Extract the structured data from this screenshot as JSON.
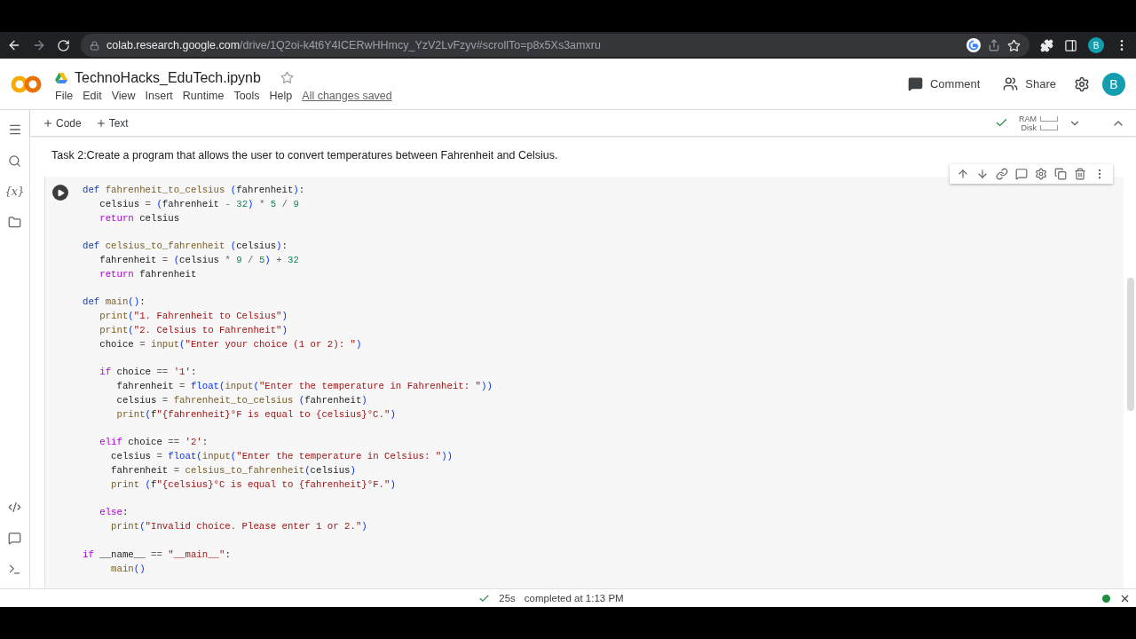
{
  "browser": {
    "url_host": "colab.research.google.com",
    "url_path": "/drive/1Q2oi-k4t6Y4ICERwHHmcy_YzV2LvFzyv#scrollTo=p8x5Xs3amxru",
    "profile": "B"
  },
  "notebook": {
    "title": "TechnoHacks_EduTech.ipynb",
    "menu": [
      "File",
      "Edit",
      "View",
      "Insert",
      "Runtime",
      "Tools",
      "Help"
    ],
    "save_status": "All changes saved",
    "comment": "Comment",
    "share": "Share",
    "avatar": "B"
  },
  "toolbar": {
    "add": [
      "Code",
      "Text"
    ],
    "ram": "RAM",
    "disk": "Disk"
  },
  "sidebar": {
    "variables": "{x}"
  },
  "text_cell": "Task 2:Create a program that allows the user to convert temperatures between Fahrenheit and Celsius.",
  "code_cell": {
    "blocks": [
      [
        "def fahrenheit_to_celsius (fahrenheit):",
        "   celsius = (fahrenheit - 32) * 5 / 9",
        "   return celsius"
      ],
      [
        "def celsius_to_fahrenheit (celsius):",
        "   fahrenheit = (celsius * 9 / 5) + 32",
        "   return fahrenheit"
      ],
      [
        "def main():",
        "   print(\"1. Fahrenheit to Celsius\")",
        "   print(\"2. Celsius to Fahrenheit\")",
        "   choice = input(\"Enter your choice (1 or 2): \")"
      ],
      [
        "   if choice == '1':",
        "      fahrenheit = float(input(\"Enter the temperature in Fahrenheit: \"))",
        "      celsius = fahrenheit_to_celsius (fahrenheit)",
        "      print(f\"{fahrenheit}°F is equal to {celsius}°C.\")"
      ],
      [
        "   elif choice == '2':",
        "     celsius = float(input(\"Enter the temperature in Celsius: \"))",
        "     fahrenheit = celsius_to_fahrenheit(celsius)",
        "     print (f\"{celsius}°C is equal to {fahrenheit}°F.\")"
      ],
      [
        "   else:",
        "     print(\"Invalid choice. Please enter 1 or 2.\")"
      ],
      [
        "if __name__ == \"__main__\":",
        "     main()"
      ]
    ]
  },
  "status_bar": {
    "duration": "25s",
    "message": "completed at 1:13 PM"
  }
}
